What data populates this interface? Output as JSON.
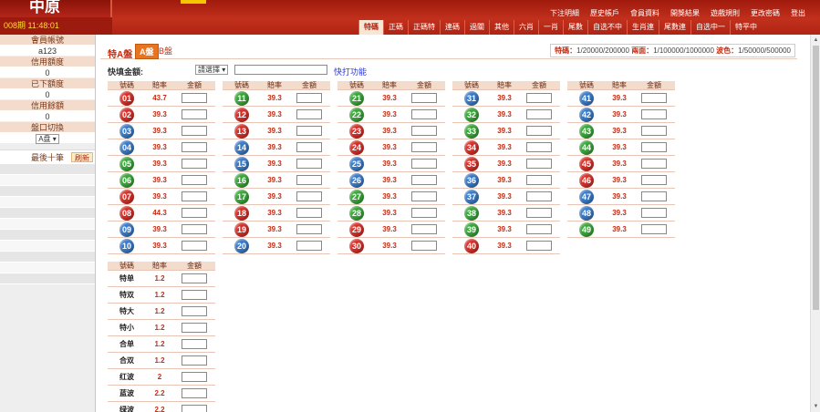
{
  "header": {
    "logo": "中原",
    "period": "008期",
    "time": "11:48:01"
  },
  "links": [
    "下注明細",
    "歷史帳戶",
    "會員資料",
    "開獎結果",
    "遊戲規則",
    "更改密碼",
    "登出"
  ],
  "tabs": [
    "特碼",
    "正碼",
    "正碼特",
    "連碼",
    "過關",
    "其他",
    "六肖",
    "一肖",
    "尾數",
    "自选不中",
    "生肖連",
    "尾數連",
    "自选中一",
    "特平中"
  ],
  "active_tab": 0,
  "sidebar": {
    "fields": [
      {
        "label": "會員帳號",
        "value": "a123"
      },
      {
        "label": "信用額度",
        "value": "0"
      },
      {
        "label": "已下額度",
        "value": "0"
      },
      {
        "label": "信用餘額",
        "value": "0"
      },
      {
        "label": "盤口切換",
        "value": "A盘"
      }
    ],
    "recent_label": "最後十筆",
    "refresh_label": "刷新"
  },
  "panel": {
    "label": "特A盤",
    "a_btn": "A盤",
    "b_btn": "B盤"
  },
  "odds_bar": {
    "t_label": "特碼：",
    "t_val": "1/20000/200000",
    "l_label": "兩面：",
    "l_val": "1/100000/1000000",
    "s_label": "波色：",
    "s_val": "1/50000/500000"
  },
  "quick": {
    "label": "快填金額:",
    "select": "請選擇",
    "link": "快打功能"
  },
  "headers": {
    "num": "號碼",
    "rate": "賠率",
    "amount": "金額"
  },
  "numbers": [
    {
      "n": "01",
      "rate": "43.7",
      "c": "r"
    },
    {
      "n": "02",
      "rate": "39.3",
      "c": "r"
    },
    {
      "n": "03",
      "rate": "39.3",
      "c": "b"
    },
    {
      "n": "04",
      "rate": "39.3",
      "c": "b"
    },
    {
      "n": "05",
      "rate": "39.3",
      "c": "g"
    },
    {
      "n": "06",
      "rate": "39.3",
      "c": "g"
    },
    {
      "n": "07",
      "rate": "39.3",
      "c": "r"
    },
    {
      "n": "08",
      "rate": "44.3",
      "c": "r"
    },
    {
      "n": "09",
      "rate": "39.3",
      "c": "b"
    },
    {
      "n": "10",
      "rate": "39.3",
      "c": "b"
    },
    {
      "n": "11",
      "rate": "39.3",
      "c": "g"
    },
    {
      "n": "12",
      "rate": "39.3",
      "c": "r"
    },
    {
      "n": "13",
      "rate": "39.3",
      "c": "r"
    },
    {
      "n": "14",
      "rate": "39.3",
      "c": "b"
    },
    {
      "n": "15",
      "rate": "39.3",
      "c": "b"
    },
    {
      "n": "16",
      "rate": "39.3",
      "c": "g"
    },
    {
      "n": "17",
      "rate": "39.3",
      "c": "g"
    },
    {
      "n": "18",
      "rate": "39.3",
      "c": "r"
    },
    {
      "n": "19",
      "rate": "39.3",
      "c": "r"
    },
    {
      "n": "20",
      "rate": "39.3",
      "c": "b"
    },
    {
      "n": "21",
      "rate": "39.3",
      "c": "g"
    },
    {
      "n": "22",
      "rate": "39.3",
      "c": "g"
    },
    {
      "n": "23",
      "rate": "39.3",
      "c": "r"
    },
    {
      "n": "24",
      "rate": "39.3",
      "c": "r"
    },
    {
      "n": "25",
      "rate": "39.3",
      "c": "b"
    },
    {
      "n": "26",
      "rate": "39.3",
      "c": "b"
    },
    {
      "n": "27",
      "rate": "39.3",
      "c": "g"
    },
    {
      "n": "28",
      "rate": "39.3",
      "c": "g"
    },
    {
      "n": "29",
      "rate": "39.3",
      "c": "r"
    },
    {
      "n": "30",
      "rate": "39.3",
      "c": "r"
    },
    {
      "n": "31",
      "rate": "39.3",
      "c": "b"
    },
    {
      "n": "32",
      "rate": "39.3",
      "c": "g"
    },
    {
      "n": "33",
      "rate": "39.3",
      "c": "g"
    },
    {
      "n": "34",
      "rate": "39.3",
      "c": "r"
    },
    {
      "n": "35",
      "rate": "39.3",
      "c": "r"
    },
    {
      "n": "36",
      "rate": "39.3",
      "c": "b"
    },
    {
      "n": "37",
      "rate": "39.3",
      "c": "b"
    },
    {
      "n": "38",
      "rate": "39.3",
      "c": "g"
    },
    {
      "n": "39",
      "rate": "39.3",
      "c": "g"
    },
    {
      "n": "40",
      "rate": "39.3",
      "c": "r"
    },
    {
      "n": "41",
      "rate": "39.3",
      "c": "b"
    },
    {
      "n": "42",
      "rate": "39.3",
      "c": "b"
    },
    {
      "n": "43",
      "rate": "39.3",
      "c": "g"
    },
    {
      "n": "44",
      "rate": "39.3",
      "c": "g"
    },
    {
      "n": "45",
      "rate": "39.3",
      "c": "r"
    },
    {
      "n": "46",
      "rate": "39.3",
      "c": "r"
    },
    {
      "n": "47",
      "rate": "39.3",
      "c": "b"
    },
    {
      "n": "48",
      "rate": "39.3",
      "c": "b"
    },
    {
      "n": "49",
      "rate": "39.3",
      "c": "g"
    }
  ],
  "two_sided": [
    {
      "name": "特单",
      "rate": "1.2"
    },
    {
      "name": "特双",
      "rate": "1.2"
    },
    {
      "name": "特大",
      "rate": "1.2"
    },
    {
      "name": "特小",
      "rate": "1.2"
    },
    {
      "name": "合单",
      "rate": "1.2"
    },
    {
      "name": "合双",
      "rate": "1.2"
    },
    {
      "name": "红波",
      "rate": "2"
    },
    {
      "name": "蓝波",
      "rate": "2.2"
    },
    {
      "name": "绿波",
      "rate": "2.2"
    }
  ],
  "colors": {
    "red": "#d63028",
    "blue": "#3a7bc8",
    "green": "#3aa63a",
    "brand": "#b12414"
  }
}
